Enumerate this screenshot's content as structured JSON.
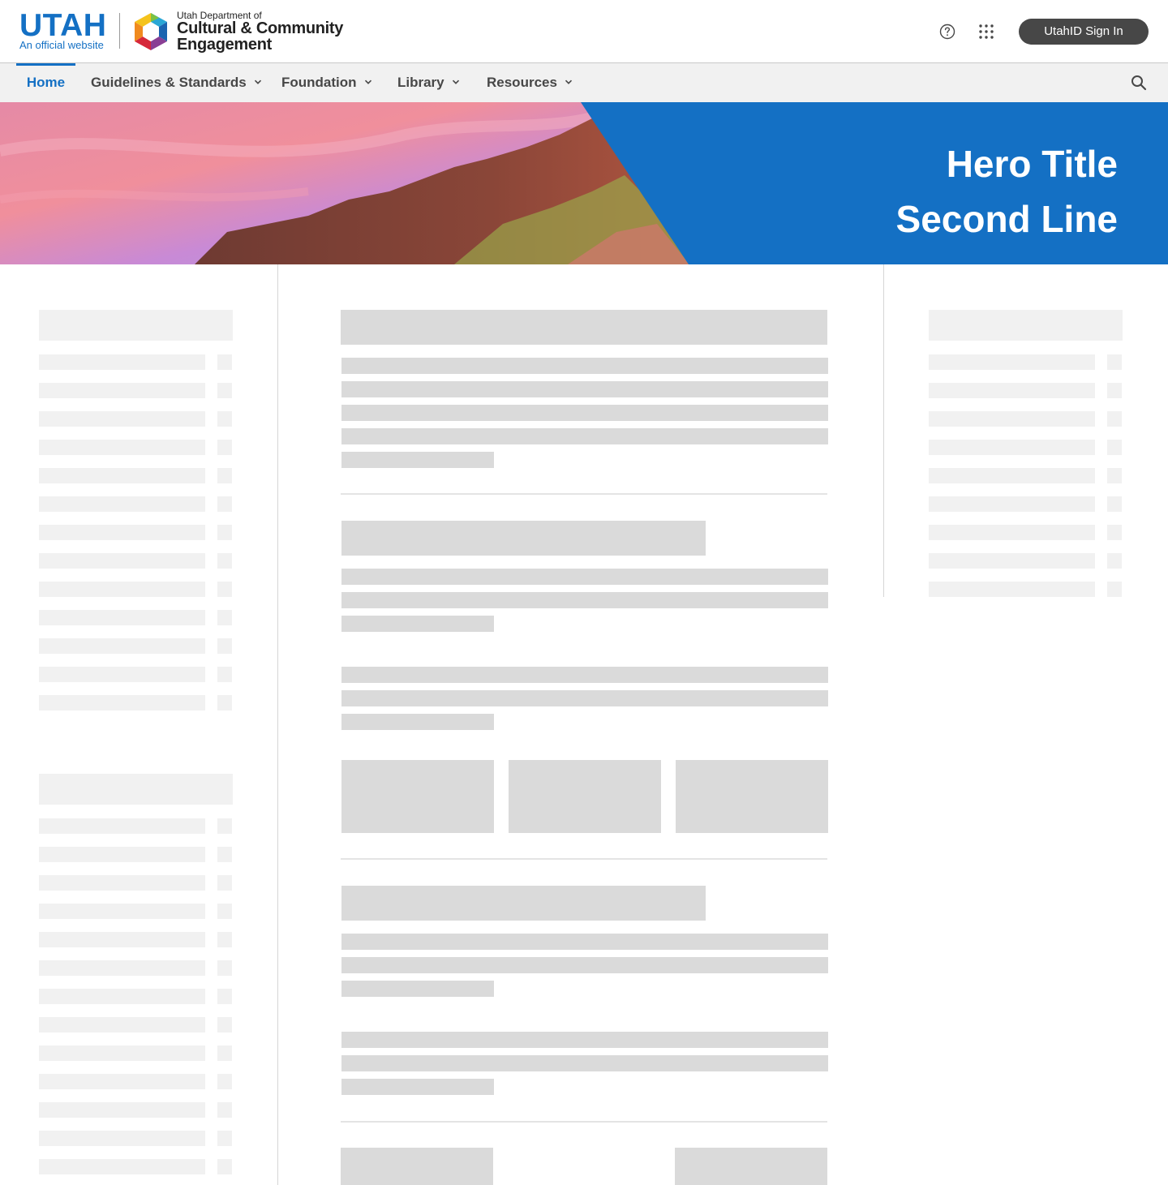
{
  "header": {
    "utah_logo_text": "UTAH",
    "official_site_text": "An official website",
    "agency_line_small": "Utah Department of",
    "agency_line_big_1": "Cultural & Community",
    "agency_line_big_2": "Engagement",
    "help_icon": "help-circle-icon",
    "apps_icon": "apps-grid-icon",
    "signin_label": "UtahID Sign In"
  },
  "nav": {
    "items": [
      {
        "label": "Home",
        "active": true,
        "has_dropdown": false
      },
      {
        "label": "Guidelines & Standards",
        "active": false,
        "has_dropdown": true
      },
      {
        "label": "Foundation",
        "active": false,
        "has_dropdown": true
      },
      {
        "label": "Library",
        "active": false,
        "has_dropdown": true
      },
      {
        "label": "Resources",
        "active": false,
        "has_dropdown": true
      }
    ],
    "search_icon": "search-icon"
  },
  "hero": {
    "title_line_1": "Hero Title",
    "title_line_2": "Second Line",
    "panel_color": "#1470c4"
  },
  "colors": {
    "brand_blue": "#1470c4",
    "signin_bg": "#474747",
    "nav_bg": "#f1f1f1",
    "skeleton_light": "#f1f1f1",
    "skeleton_dark": "#dadada"
  }
}
